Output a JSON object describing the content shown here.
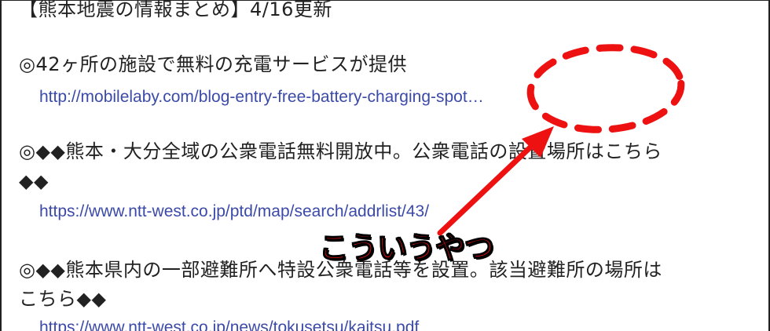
{
  "header": {
    "text": "【熊本地震の情報まとめ】4/16更新"
  },
  "items": [
    {
      "title_lines": [
        "◎42ヶ所の施設で無料の充電サービスが提供"
      ],
      "link": "http://mobilelaby.com/blog-entry-free-battery-charging-spot…"
    },
    {
      "title_lines": [
        "◎◆◆熊本・大分全域の公衆電話無料開放中。公衆電話の設置場所はこちら",
        "◆◆"
      ],
      "link": "https://www.ntt-west.co.jp/ptd/map/search/addrlist/43/"
    },
    {
      "title_lines": [
        "◎◆◆熊本県内の一部避難所へ特設公衆電話等を設置。該当避難所の場所は",
        "こちら◆◆"
      ],
      "link": "https://www.ntt-west.co.jp/news/tokusetsu/kaitsu.pdf"
    }
  ],
  "annotation": {
    "label": "こういうやつ",
    "color": "#ee1111"
  }
}
